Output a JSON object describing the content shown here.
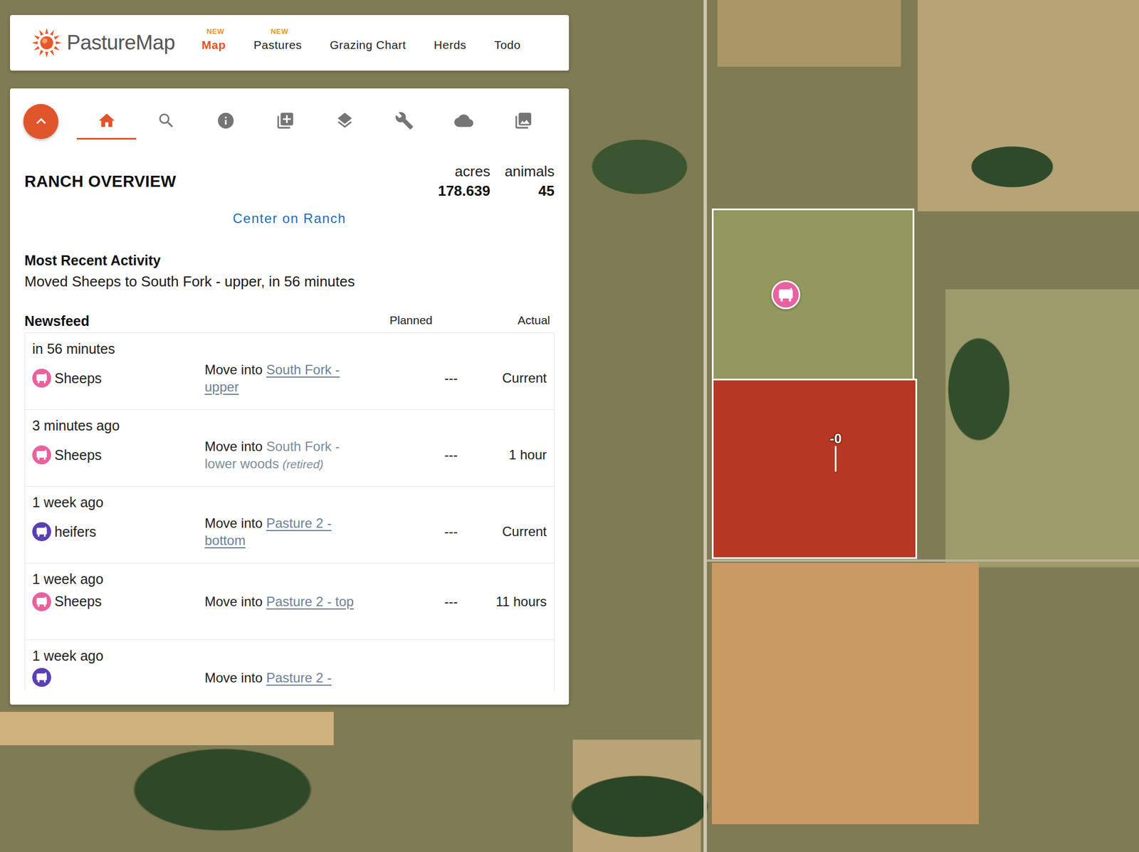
{
  "app": {
    "logo": "PastureMap"
  },
  "nav": [
    {
      "label": "Map",
      "badge": "NEW",
      "selected": true
    },
    {
      "label": "Pastures",
      "badge": "NEW",
      "selected": false
    },
    {
      "label": "Grazing Chart",
      "selected": false
    },
    {
      "label": "Herds",
      "selected": false
    },
    {
      "label": "Todo",
      "selected": false
    }
  ],
  "toolbar": [
    {
      "selected": true
    },
    {
      "selected": false
    },
    {
      "selected": false
    },
    {
      "selected": false
    },
    {
      "selected": false
    },
    {
      "selected": false
    },
    {
      "selected": false
    },
    {
      "selected": false
    }
  ],
  "overview": {
    "title": "RANCH OVERVIEW",
    "stats": [
      {
        "label": "acres",
        "value": "178.639"
      },
      {
        "label": "animals",
        "value": "45"
      }
    ],
    "center_link": "Center on Ranch"
  },
  "recent_activity": {
    "heading": "Most Recent Activity",
    "text": "Moved Sheeps to South Fork - upper, in 56 minutes"
  },
  "newsfeed": {
    "heading": "Newsfeed",
    "columns": [
      "Planned",
      "Actual"
    ],
    "rows": [
      {
        "kind": "full",
        "time": "in 56 minutes",
        "herd": "Sheeps",
        "color": "#e8629f",
        "action": "Move into",
        "pasture": "South Fork - upper",
        "retired": false,
        "planned": "---",
        "actual": "Current"
      },
      {
        "kind": "full",
        "time": "3 minutes ago",
        "herd": "Sheeps",
        "color": "#e8629f",
        "action": "Move into",
        "pasture": "South Fork - lower woods",
        "retired": true,
        "retired_note": "(retired)",
        "planned": "---",
        "actual": "1 hour"
      },
      {
        "kind": "full",
        "time": "1 week ago",
        "herd": "heifers",
        "color": "#5a3fb5",
        "action": "Move into",
        "pasture": "Pasture 2 - bottom",
        "retired": false,
        "planned": "---",
        "actual": "Current"
      },
      {
        "kind": "full",
        "time": "1 week ago",
        "herd": "Sheeps",
        "color": "#e8629f",
        "action": "Move into",
        "pasture": "Pasture 2 - top",
        "retired": false,
        "planned": "---",
        "actual": "11 hours"
      },
      {
        "kind": "cut",
        "time": "1 week ago",
        "color": "#5a3fb5",
        "action": "Move into",
        "pasture": "Pasture 2 -",
        "retired": false
      }
    ]
  },
  "map": {
    "pastures": [
      {
        "highlighted": false
      },
      {
        "highlighted": true
      }
    ],
    "markers": [
      {
        "color": "#e8629f"
      }
    ],
    "flags": [
      {
        "label": "-0"
      }
    ]
  }
}
